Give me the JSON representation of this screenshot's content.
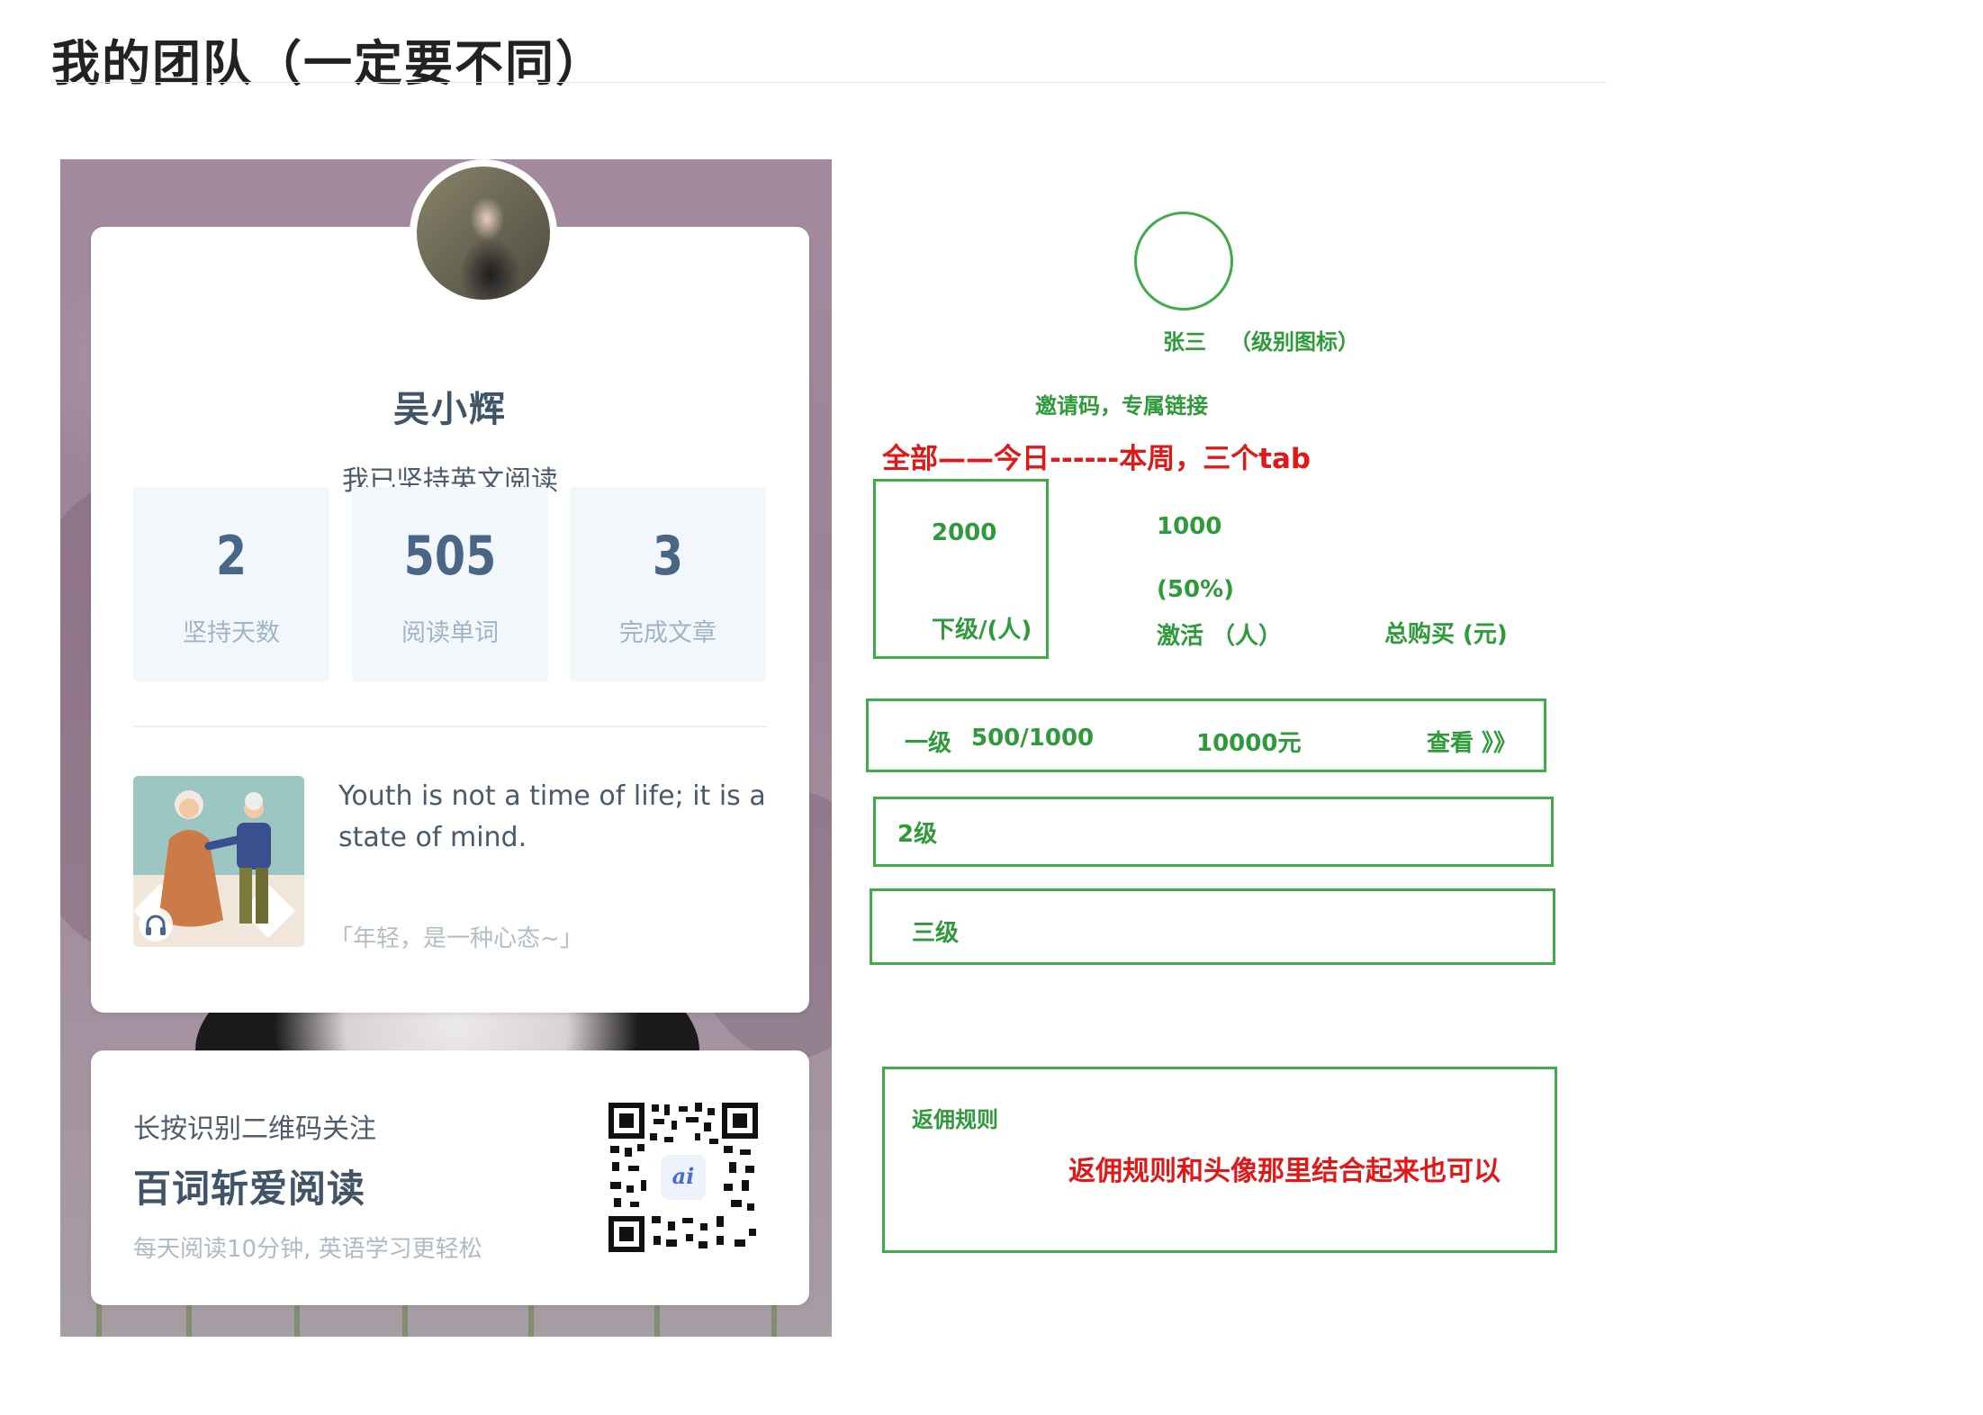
{
  "page": {
    "title": "我的团队（一定要不同）"
  },
  "poster": {
    "user_name": "吴小辉",
    "slogan": "我已坚持英文阅读",
    "stats": [
      {
        "value": "2",
        "label": "坚持天数"
      },
      {
        "value": "505",
        "label": "阅读单词"
      },
      {
        "value": "3",
        "label": "完成文章"
      }
    ],
    "quote_en": "Youth is not a time of life; it is a state of mind.",
    "quote_cn": "「年轻，是一种心态~」",
    "follow_hint": "长按识别二维码关注",
    "follow_brand": "百词斩爱阅读",
    "follow_sub": "每天阅读10分钟, 英语学习更轻松",
    "qr_logo": "ai"
  },
  "wireframe": {
    "profile_label": "张三",
    "level_icon_note": "（级别图标）",
    "invite_note": "邀请码，专属链接",
    "tabs_note": "全部——今日------本周，三个tab",
    "subordinates": {
      "value": "2000",
      "label": "下级/(人)"
    },
    "activated": {
      "value": "1000",
      "percent": "(50%)",
      "label": "激活 （人）"
    },
    "total_purchase": {
      "label": "总购买 (元)"
    },
    "levels": [
      {
        "level": "一级",
        "count": "500/1000",
        "amount": "10000元",
        "link": "查看 》》"
      },
      {
        "level": "2级"
      },
      {
        "level": "三级"
      }
    ],
    "rebate_title": "返佣规则",
    "rebate_note": "返佣规则和头像那里结合起来也可以"
  },
  "colors": {
    "wire_green": "#3fab4a",
    "note_red": "#e11818",
    "poster_text": "#3f5467",
    "stat_bg": "#f2f7fc"
  }
}
